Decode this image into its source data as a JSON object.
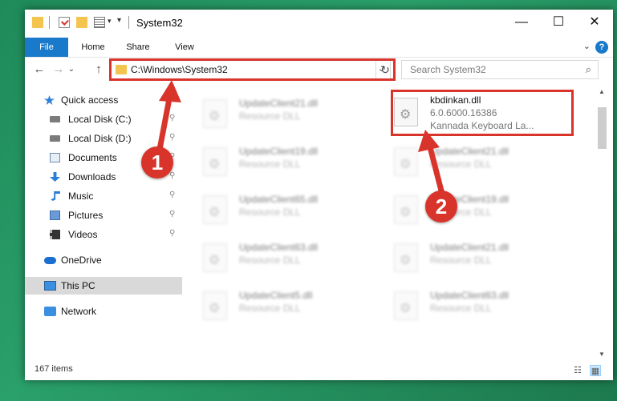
{
  "window": {
    "title": "System32",
    "controls": {
      "minimize": "—",
      "maximize": "☐",
      "close": "✕"
    }
  },
  "ribbon": {
    "tabs": [
      "File",
      "Home",
      "Share",
      "View"
    ],
    "help": "?",
    "collapse": "⌄"
  },
  "nav": {
    "back": "←",
    "forward": "→",
    "up": "↑",
    "recent": "⌄",
    "address": "C:\\Windows\\System32",
    "address_dropdown": "⌄",
    "refresh": "↻",
    "search_placeholder": "Search System32",
    "search_icon": "⌕"
  },
  "sidebar": {
    "items": [
      {
        "label": "Quick access",
        "icon": "star-icon",
        "pinned": false
      },
      {
        "label": "Local Disk (C:)",
        "icon": "disk-icon",
        "pinned": true
      },
      {
        "label": "Local Disk (D:)",
        "icon": "disk-icon",
        "pinned": true
      },
      {
        "label": "Documents",
        "icon": "documents-icon",
        "pinned": true
      },
      {
        "label": "Downloads",
        "icon": "downloads-icon",
        "pinned": true
      },
      {
        "label": "Music",
        "icon": "music-icon",
        "pinned": true
      },
      {
        "label": "Pictures",
        "icon": "pictures-icon",
        "pinned": true
      },
      {
        "label": "Videos",
        "icon": "videos-icon",
        "pinned": true
      },
      {
        "label": "OneDrive",
        "icon": "onedrive-icon",
        "pinned": false
      },
      {
        "label": "This PC",
        "icon": "this-pc-icon",
        "pinned": false,
        "selected": true
      },
      {
        "label": "Network",
        "icon": "network-icon",
        "pinned": false
      }
    ],
    "pin_glyph": "📌"
  },
  "files": {
    "highlighted": {
      "name": "kbdinkan.dll",
      "version": "6.0.6000.16386",
      "description": "Kannada Keyboard La..."
    },
    "left_column": [
      {
        "name": "UpdateClient21.dll",
        "type": "Resource DLL"
      },
      {
        "name": "UpdateClient19.dll",
        "type": "Resource DLL"
      },
      {
        "name": "UpdateClient65.dll",
        "type": "Resource DLL"
      },
      {
        "name": "UpdateClient63.dll",
        "type": "Resource DLL"
      },
      {
        "name": "UpdateClient5.dll",
        "type": "Resource DLL"
      }
    ],
    "right_column": [
      {
        "name": "UpdateClient21.dll",
        "type": "Resource DLL"
      },
      {
        "name": "UpdateClient19.dll",
        "type": "Resource DLL"
      },
      {
        "name": "UpdateClient21.dll",
        "type": "Resource DLL"
      },
      {
        "name": "UpdateClient63.dll",
        "type": "Resource DLL"
      }
    ]
  },
  "status": {
    "item_count": "167 items"
  },
  "callouts": {
    "one": "1",
    "two": "2"
  },
  "colors": {
    "accent": "#1979ca",
    "highlight": "#d8342b"
  }
}
